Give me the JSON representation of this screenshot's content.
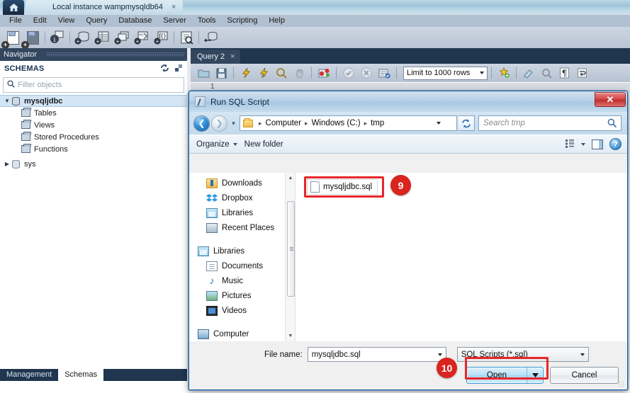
{
  "workbench": {
    "instance_tab": {
      "label": "Local instance wampmysqldb64",
      "close": "×"
    },
    "home_icon": "home-icon",
    "menu": [
      "File",
      "Edit",
      "View",
      "Query",
      "Database",
      "Server",
      "Tools",
      "Scripting",
      "Help"
    ],
    "toolbar_icons": [
      "new-sql-tab-icon",
      "open-sql-script-icon",
      "server-status-icon",
      "new-schema-icon",
      "new-table-icon",
      "new-view-icon",
      "new-stored-procedure-icon",
      "new-function-icon",
      "inspect-object-icon",
      "reconnect-server-icon"
    ],
    "navigator": {
      "title": "Navigator",
      "section_label": "SCHEMAS",
      "section_icons": [
        "refresh-schemas-icon",
        "collapse-all-icon"
      ],
      "filter_placeholder": "Filter objects",
      "search_icon": "search-icon",
      "tree": [
        {
          "label": "mysqljdbc",
          "level": 0,
          "expanded": true,
          "selected": true,
          "icon": "schema-icon"
        },
        {
          "label": "Tables",
          "level": 1,
          "icon": "folder-icon"
        },
        {
          "label": "Views",
          "level": 1,
          "icon": "folder-icon"
        },
        {
          "label": "Stored Procedures",
          "level": 1,
          "icon": "folder-icon"
        },
        {
          "label": "Functions",
          "level": 1,
          "icon": "folder-icon"
        },
        {
          "label": "sys",
          "level": 0,
          "expanded": false,
          "icon": "schema-icon"
        }
      ],
      "bottom_tabs": [
        {
          "label": "Management",
          "active": false
        },
        {
          "label": "Schemas",
          "active": true
        }
      ]
    },
    "query_area": {
      "tab_label": "Query 2",
      "tab_close": "×",
      "toolbar_icons": [
        "open-script-icon",
        "save-script-icon",
        "execute-icon",
        "execute-current-statement-icon",
        "explain-icon",
        "stop-icon",
        "toggle-breakpoint-icon",
        "commit-icon",
        "rollback-icon",
        "auto-commit-icon",
        "beautify-icon",
        "find-icon",
        "toggle-invisible-chars-icon",
        "wrap-lines-icon"
      ],
      "limit_select": "Limit to 1000 rows",
      "line_number": "1"
    }
  },
  "dialog": {
    "title": "Run SQL Script",
    "title_icon": "sql-script-icon",
    "close_label": "✕",
    "nav": {
      "back_icon": "back-arrow-icon",
      "forward_icon": "forward-arrow-icon",
      "recent_dropdown_icon": "chevron-down-icon",
      "breadcrumbs": [
        "Computer",
        "Windows (C:)",
        "tmp"
      ],
      "breadcrumb_separator": "▸",
      "address_dropdown_icon": "chevron-down-icon",
      "refresh_icon": "refresh-icon",
      "search_placeholder": "Search tmp",
      "search_icon": "search-icon"
    },
    "commandbar": {
      "organize": "Organize",
      "new_folder": "New folder",
      "views_icon": "view-options-icon",
      "preview_pane_icon": "preview-pane-icon",
      "help_icon": "help-icon",
      "help_glyph": "?"
    },
    "navpane": [
      {
        "label": "Downloads",
        "icon": "downloads-icon",
        "group": 0
      },
      {
        "label": "Dropbox",
        "icon": "dropbox-icon",
        "group": 0
      },
      {
        "label": "Libraries",
        "icon": "libraries-icon",
        "group": 0
      },
      {
        "label": "Recent Places",
        "icon": "recent-places-icon",
        "group": 0
      },
      {
        "label": "Libraries",
        "icon": "libraries-icon",
        "group": 1,
        "root": true
      },
      {
        "label": "Documents",
        "icon": "documents-icon",
        "group": 1
      },
      {
        "label": "Music",
        "icon": "music-icon",
        "group": 1
      },
      {
        "label": "Pictures",
        "icon": "pictures-icon",
        "group": 1
      },
      {
        "label": "Videos",
        "icon": "videos-icon",
        "group": 1
      },
      {
        "label": "Computer",
        "icon": "computer-icon",
        "group": 2,
        "root": true
      }
    ],
    "files": [
      {
        "name": "mysqljdbc.sql",
        "icon": "sql-file-icon",
        "selected": true
      }
    ],
    "footer": {
      "filename_label": "File name:",
      "filename_value": "mysqljdbc.sql",
      "filetype_value": "SQL Scripts (*.sql)",
      "open_label": "Open",
      "open_dropdown_icon": "chevron-down-icon",
      "cancel_label": "Cancel"
    }
  },
  "annotations": {
    "badges": [
      {
        "number": "9",
        "target": "file-tile"
      },
      {
        "number": "10",
        "target": "open-button"
      }
    ],
    "highlight_color": "#e8262a",
    "badge_color": "#d9241f"
  }
}
